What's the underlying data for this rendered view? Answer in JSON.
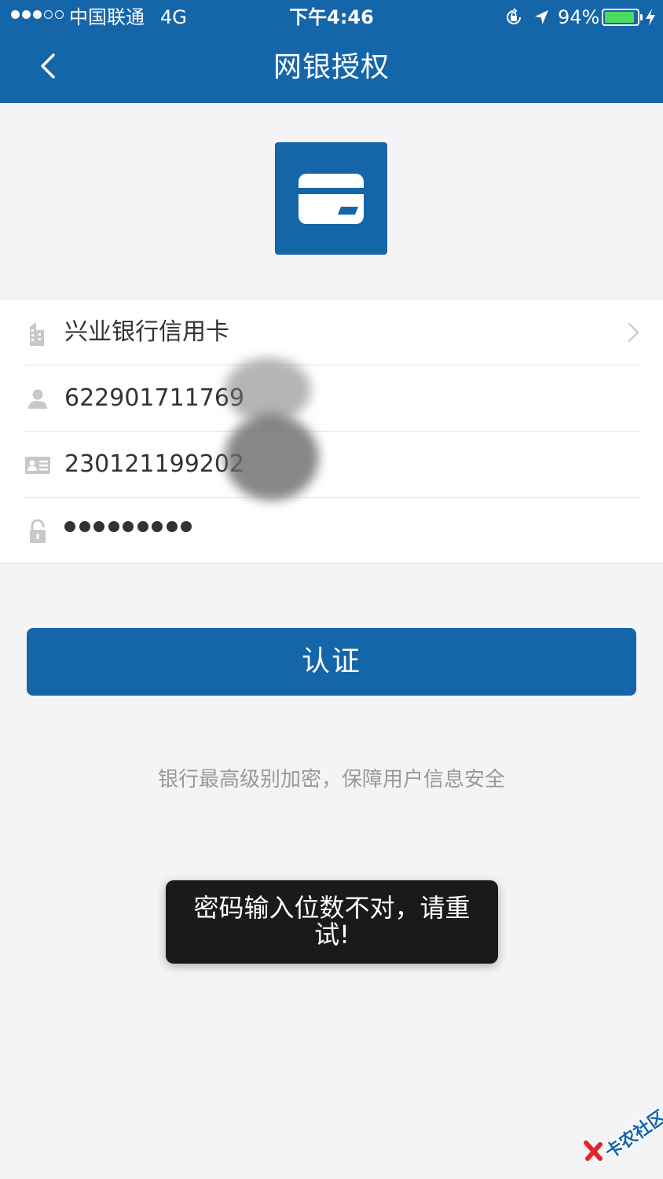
{
  "status_bar": {
    "carrier": "中国联通",
    "network": "4G",
    "time": "下午4:46",
    "battery_percent": "94%",
    "battery_level": 0.94,
    "signal_bars_filled": 3,
    "signal_bars_total": 5
  },
  "nav": {
    "title": "网银授权",
    "back_icon": "chevron-left-icon"
  },
  "bank_logo_icon": "credit-card-icon",
  "form": {
    "bank": {
      "icon": "building-icon",
      "value": "兴业银行信用卡",
      "chevron": "chevron-right-icon"
    },
    "card_number": {
      "icon": "user-icon",
      "value": "622901711769"
    },
    "id_number": {
      "icon": "id-card-icon",
      "value": "230121199202"
    },
    "password": {
      "icon": "lock-icon",
      "masked_length": 9
    }
  },
  "submit_label": "认证",
  "security_note": "银行最高级别加密，保障用户信息安全",
  "toast_message": "密码输入位数不对，请重试!",
  "watermark": "卡农社区",
  "colors": {
    "brand_blue": "#1565a9",
    "background": "#f4f4f6",
    "battery_green": "#4cd964",
    "toast_bg": "#1a1a1a",
    "note_gray": "#999999"
  }
}
